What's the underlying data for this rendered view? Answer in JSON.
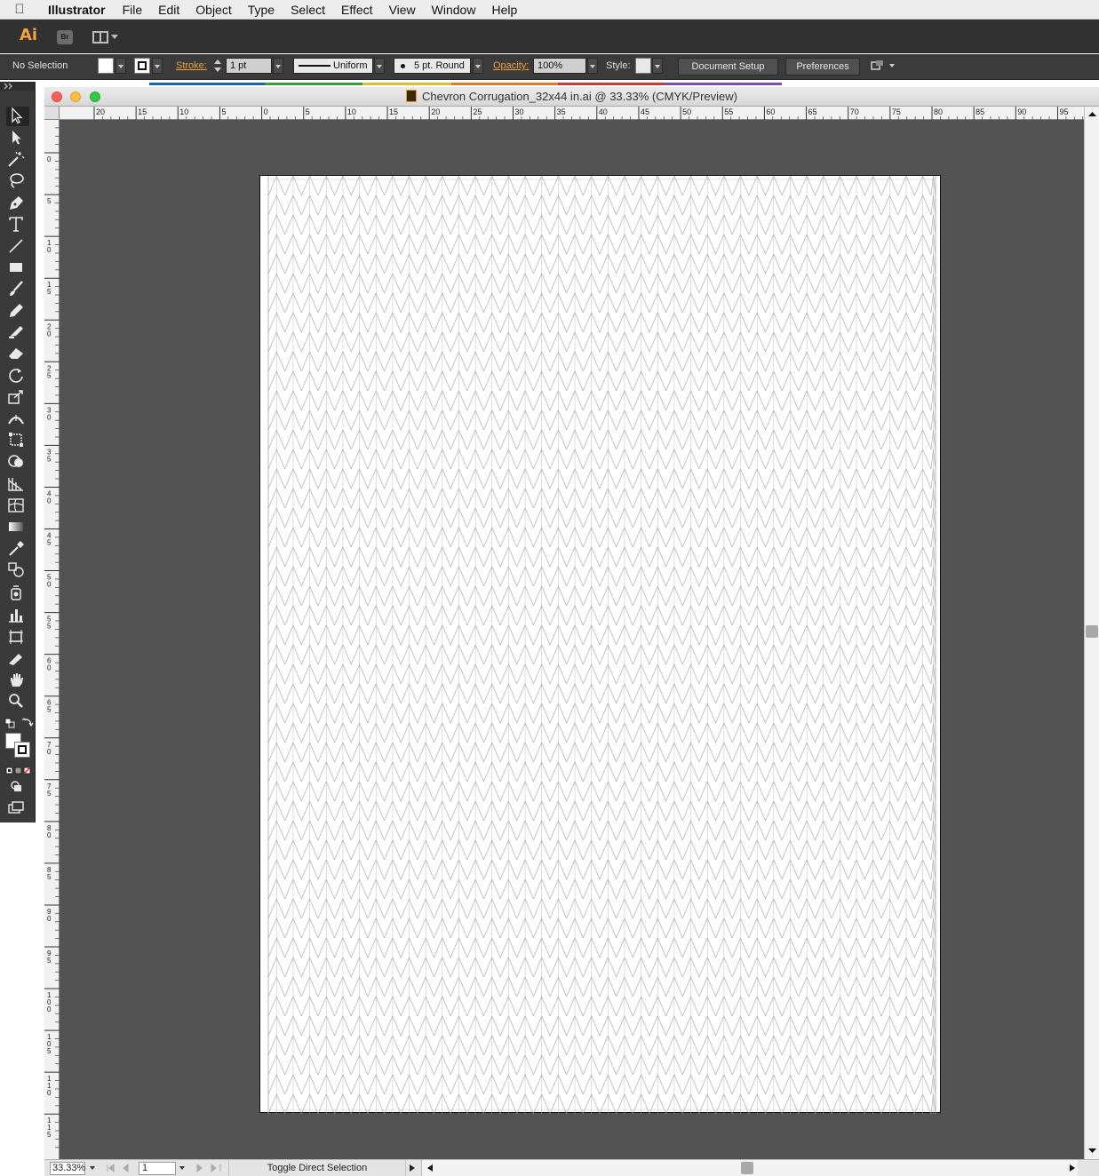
{
  "menubar": {
    "app_name": "Illustrator",
    "items": [
      "File",
      "Edit",
      "Object",
      "Type",
      "Select",
      "Effect",
      "View",
      "Window",
      "Help"
    ]
  },
  "appbar": {
    "logo": "Ai",
    "bridge_label": "Br"
  },
  "control": {
    "selection": "No Selection",
    "stroke_label": "Stroke:",
    "stroke_weight": "1 pt",
    "stroke_profile": "Uniform",
    "brush": "5 pt. Round",
    "opacity_label": "Opacity:",
    "opacity_value": "100%",
    "style_label": "Style:",
    "document_setup": "Document Setup",
    "preferences": "Preferences"
  },
  "document": {
    "title": "Chevron Corrugation_32x44 in.ai @ 33.33% (CMYK/Preview)",
    "zoom": "33.33%",
    "artboard_number": "1",
    "status": "Toggle Direct Selection"
  },
  "rulers": {
    "horizontal": [
      "20",
      "15",
      "10",
      "5",
      "0",
      "5",
      "10",
      "15",
      "20",
      "25",
      "30",
      "35",
      "40",
      "45",
      "50",
      "55",
      "60",
      "65",
      "70",
      "75",
      "80",
      "85",
      "90",
      "95"
    ],
    "vertical": [
      "5",
      "0",
      "5",
      "10",
      "15",
      "20",
      "25",
      "30",
      "35",
      "40",
      "45",
      "50",
      "55",
      "60",
      "65",
      "70",
      "75",
      "80",
      "85",
      "90",
      "95",
      "100",
      "105",
      "110",
      "115"
    ]
  },
  "colors": {
    "accent": "#f0a040",
    "pasteboard": "#535353",
    "chevron_stroke": "#9a9a9a"
  },
  "tools": [
    "selection-tool",
    "direct-selection-tool",
    "magic-wand-tool",
    "lasso-tool",
    "pen-tool",
    "type-tool",
    "line-segment-tool",
    "rectangle-tool",
    "paintbrush-tool",
    "pencil-tool",
    "blob-brush-tool",
    "eraser-tool",
    "rotate-tool",
    "scale-tool",
    "width-tool",
    "free-transform-tool",
    "shape-builder-tool",
    "perspective-grid-tool",
    "mesh-tool",
    "gradient-tool",
    "eyedropper-tool",
    "blend-tool",
    "symbol-sprayer-tool",
    "column-graph-tool",
    "artboard-tool",
    "slice-tool",
    "hand-tool",
    "zoom-tool"
  ]
}
